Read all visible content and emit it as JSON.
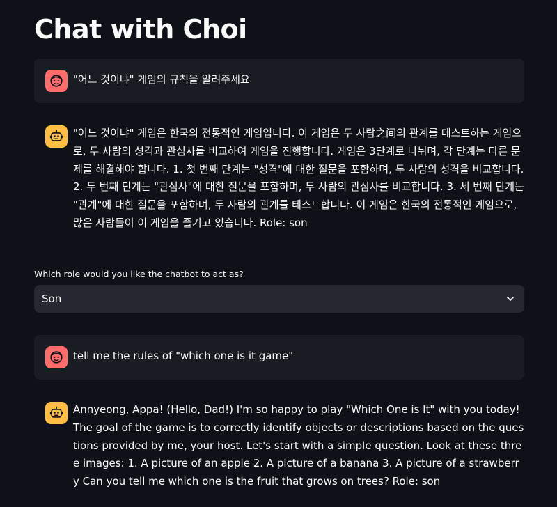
{
  "header": {
    "title": "Chat with Choi"
  },
  "messages": [
    {
      "role": "user",
      "avatar_icon": "face-icon",
      "text": "\"어느 것이냐\" 게임의 규칙을 알려주세요"
    },
    {
      "role": "assistant",
      "avatar_icon": "robot-icon",
      "text": "\"어느 것이냐\" 게임은 한국의 전통적인 게임입니다. 이 게임은 두 사람之间의 관계를 테스트하는 게임으로, 두 사람의 성격과 관심사를 비교하여 게임을 진행합니다. 게임은 3단계로 나뉘며, 각 단계는 다른 문제를 해결해야 합니다. 1. 첫 번째 단계는 \"성격\"에 대한 질문을 포함하며, 두 사람의 성격을 비교합니다. 2. 두 번째 단계는 \"관심사\"에 대한 질문을 포함하며, 두 사람의 관심사를 비교합니다. 3. 세 번째 단계는 \"관계\"에 대한 질문을 포함하며, 두 사람의 관계를 테스트합니다. 이 게임은 한국의 전통적인 게임으로, 많은 사람들이 이 게임을 즐기고 있습니다. Role: son"
    },
    {
      "role": "user",
      "avatar_icon": "face-icon",
      "text": "tell me the rules of \"which one is it game\""
    },
    {
      "role": "assistant",
      "avatar_icon": "robot-icon",
      "text": "Annyeong, Appa! (Hello, Dad!) I'm so happy to play \"Which One is It\" with you today! The goal of the game is to correctly identify objects or descriptions based on the questions provided by me, your host. Let's start with a simple question. Look at these three images: 1. A picture of an apple 2. A picture of a banana 3. A picture of a strawberry Can you tell me which one is the fruit that grows on trees? Role: son"
    }
  ],
  "role_select": {
    "label": "Which role would you like the chatbot to act as?",
    "selected": "Son",
    "icon": "chevron-down-icon"
  },
  "colors": {
    "background": "#0e1117",
    "user_bubble": "#1a1c24",
    "select_bg": "#262730",
    "user_avatar": "#ff6c6c",
    "bot_avatar": "#ffbd45",
    "text": "#fafafa"
  }
}
